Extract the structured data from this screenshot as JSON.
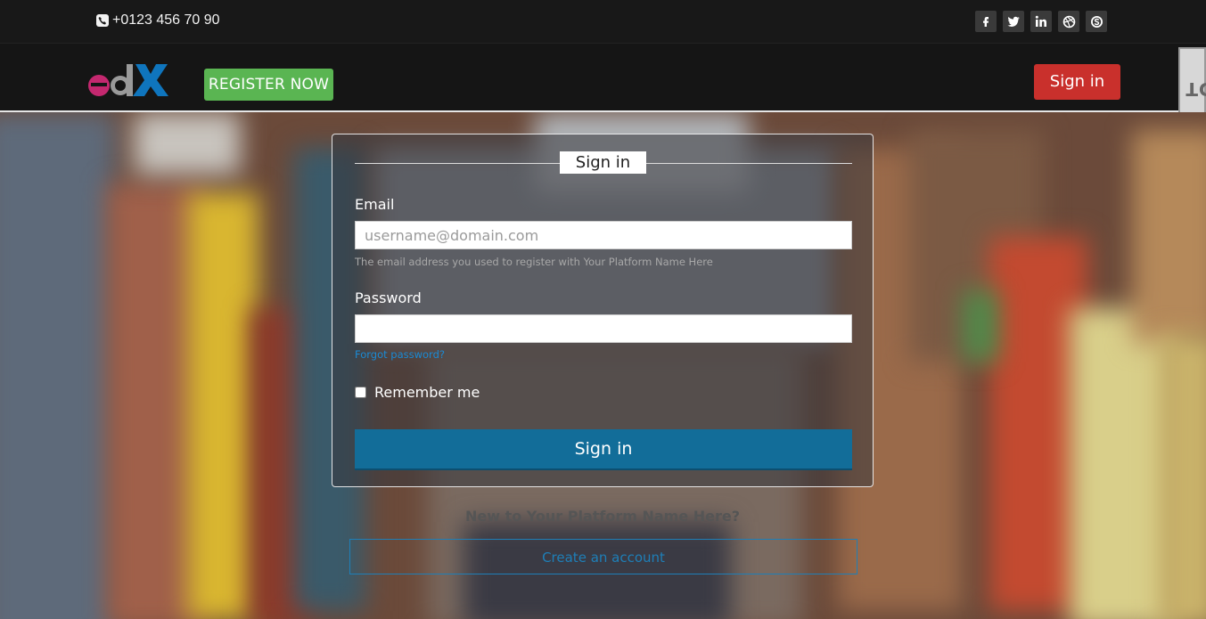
{
  "topbar": {
    "phone": "+0123 456 70 90",
    "social": [
      "facebook-icon",
      "twitter-icon",
      "linkedin-icon",
      "dribbble-icon",
      "skype-icon"
    ]
  },
  "navbar": {
    "logo_text": "edX",
    "register_label": "REGISTER NOW",
    "signin_label": "Sign in",
    "side_tab": "DjDT"
  },
  "form": {
    "title": "Sign in",
    "email_label": "Email",
    "email_placeholder": "username@domain.com",
    "email_hint": "The email address you used to register with Your Platform Name Here",
    "password_label": "Password",
    "forgot_label": "Forgot password?",
    "remember_label": "Remember me",
    "submit_label": "Sign in"
  },
  "footer": {
    "new_to": "New to Your Platform Name Here?",
    "create_label": "Create an account"
  },
  "colors": {
    "register": "#5ab552",
    "signin_top": "#c9302c",
    "submit": "#126d99",
    "link": "#1a8ad4"
  }
}
